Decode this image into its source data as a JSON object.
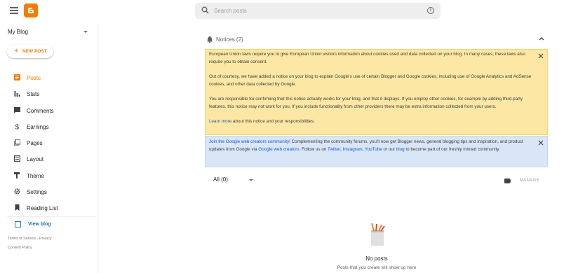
{
  "topbar": {
    "search_placeholder": "Search posts"
  },
  "sidebar": {
    "blog_name": "My Blog",
    "new_post_label": "NEW POST",
    "items": [
      {
        "label": "Posts",
        "icon": "posts-icon",
        "active": true
      },
      {
        "label": "Stats",
        "icon": "stats-icon",
        "active": false
      },
      {
        "label": "Comments",
        "icon": "comments-icon",
        "active": false
      },
      {
        "label": "Earnings",
        "icon": "dollar-icon",
        "active": false
      },
      {
        "label": "Pages",
        "icon": "pages-icon",
        "active": false
      },
      {
        "label": "Layout",
        "icon": "layout-icon",
        "active": false
      },
      {
        "label": "Theme",
        "icon": "theme-icon",
        "active": false
      },
      {
        "label": "Settings",
        "icon": "gear-icon",
        "active": false
      },
      {
        "label": "Reading List",
        "icon": "bookmark-icon",
        "active": false
      }
    ],
    "view_blog_label": "View blog",
    "legal": {
      "terms": "Terms of Service",
      "privacy": "Privacy",
      "content_policy": "Content Policy"
    }
  },
  "notices": {
    "header": "Notices (2)",
    "eu": {
      "p1": "European Union laws require you to give European Union visitors information about cookies used and data collected on your blog. In many cases, these laws also require you to obtain consent.",
      "p2": "Out of courtesy, we have added a notice on your blog to explain Google's use of certain Blogger and Google cookies, including use of Google Analytics and AdSense cookies, and other data collected by Google.",
      "p3": "You are responsible for confirming that this notice actually works for your blog, and that it displays. If you employ other cookies, for example by adding third-party features, this notice may not work for you. If you include functionality from other providers there may be extra information collected from your users.",
      "learn_more": "Learn more",
      "p4_rest": " about this notice and your responsibilities."
    },
    "community": {
      "join_link": "Join the Google web creators community!",
      "text1": " Complementing the community forums, you'll now get Blogger news, general blogging tips and inspiration, and product updates from Google via ",
      "web_creators_link": "Google web creators",
      "text2": ". Follow us on ",
      "twitter": "Twitter",
      "sep1": ", ",
      "instagram": "Instagram",
      "sep2": ", ",
      "youtube": "YouTube",
      "text3": " or our ",
      "blog": "blog",
      "text4": " to become part of our freshly minted community."
    }
  },
  "posts": {
    "filter": "All (0)",
    "manage": "MANAGE",
    "empty_title": "No posts",
    "empty_sub": "Posts that you create will show up here"
  },
  "colors": {
    "accent": "#f57c00",
    "notice_yellow": "#fce8a4",
    "notice_blue": "#d9e6f7",
    "link": "#1a56c6"
  }
}
